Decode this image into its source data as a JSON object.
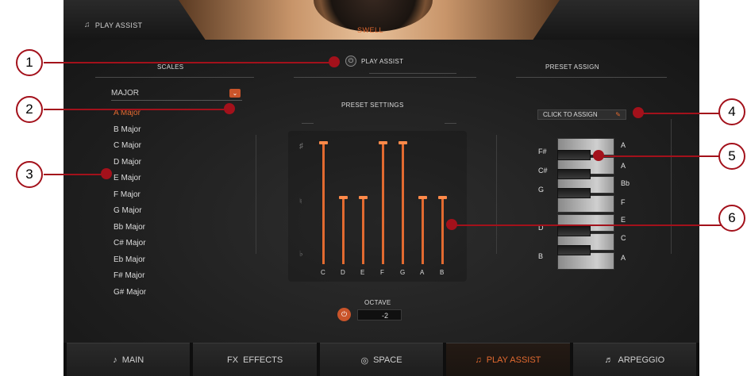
{
  "header": {
    "title": "PLAY ASSIST",
    "knob_label": "SWELL"
  },
  "play_assist_toggle": {
    "label": "PLAY ASSIST"
  },
  "scales": {
    "heading": "SCALES",
    "dropdown_value": "MAJOR",
    "items": [
      "A Major",
      "B Major",
      "C Major",
      "D Major",
      "E Major",
      "F Major",
      "G Major",
      "Bb Major",
      "C# Major",
      "Eb Major",
      "F# Major",
      "G# Major"
    ],
    "active_index": 0
  },
  "preset_settings": {
    "heading": "PRESET SETTINGS",
    "notes": [
      "C",
      "D",
      "E",
      "F",
      "G",
      "A",
      "B"
    ],
    "symbols": {
      "sharp": "♯",
      "natural": "♮",
      "flat": "♭"
    },
    "note_states": [
      "sharp",
      "natural",
      "natural",
      "sharp",
      "sharp",
      "natural",
      "natural"
    ]
  },
  "octave": {
    "label": "OCTAVE",
    "value": "-2"
  },
  "preset_assign": {
    "heading": "PRESET ASSIGN",
    "button_label": "CLICK TO ASSIGN",
    "left_labels": [
      "F#",
      "C#",
      "G",
      "D",
      "B"
    ],
    "right_labels": [
      "A",
      "A",
      "Bb",
      "F",
      "E",
      "C",
      "A"
    ]
  },
  "tabs": [
    {
      "label": "MAIN",
      "icon": "guitar-icon"
    },
    {
      "label": "EFFECTS",
      "icon": "fx-icon"
    },
    {
      "label": "SPACE",
      "icon": "space-icon"
    },
    {
      "label": "PLAY ASSIST",
      "icon": "music-notes-icon"
    },
    {
      "label": "ARPEGGIO",
      "icon": "arpeggio-icon"
    }
  ],
  "active_tab_index": 3,
  "callouts": [
    "1",
    "2",
    "3",
    "4",
    "5",
    "6"
  ],
  "colors": {
    "accent": "#e26a30",
    "callout": "#a3111b",
    "background": "#1b1b1b"
  }
}
